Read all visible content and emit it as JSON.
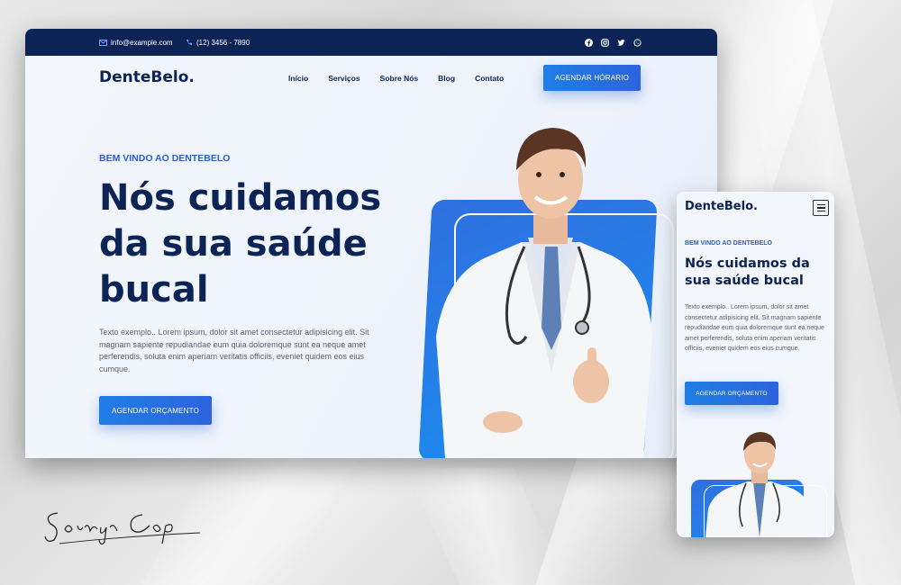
{
  "colors": {
    "navy": "#0b2455",
    "accent": "#2a5ed4",
    "button": "#1f7ee6"
  },
  "desktop": {
    "topbar": {
      "email": "info@example.com",
      "phone": "(12) 3456 - 7890",
      "socials": [
        "facebook-icon",
        "instagram-icon",
        "twitter-icon",
        "whatsapp-icon"
      ]
    },
    "logo": "DenteBelo.",
    "nav": [
      "Início",
      "Serviços",
      "Sobre Nós",
      "Blog",
      "Contato"
    ],
    "cta": "AGENDAR HÓRARIO",
    "hero": {
      "eyebrow": "BEM VINDO AO DENTEBELO",
      "headline": "Nós cuidamos da sua saúde bucal",
      "body": "Texto exemplo.. Lorem ipsum, dolor sit amet consectetur adipisicing elit. Sit magnam sapiente repudiandae eum quia doloremque sunt ea neque amet perferendis, soluta enim aperiam veritatis officiis, eveniet quidem eos eius cumque.",
      "button": "AGENDAR ORÇAMENTO"
    }
  },
  "mobile": {
    "logo": "DenteBelo.",
    "menu_icon": "hamburger-menu-icon",
    "eyebrow": "BEM VINDO AO DENTEBELO",
    "headline": "Nós cuidamos da sua saúde bucal",
    "body": "Texto exemplo.. Lorem ipsum, dolor sit amet consectetur adipisicing elit. Sit magnam sapiente repudiandae eum quia doloremque sunt ea neque amet perferendis, soluta enim aperiam veritatis officiis, eveniet quidem eos eius cumque.",
    "button": "AGENDAR ORÇAMENTO"
  },
  "signature": "Soraya Cop"
}
